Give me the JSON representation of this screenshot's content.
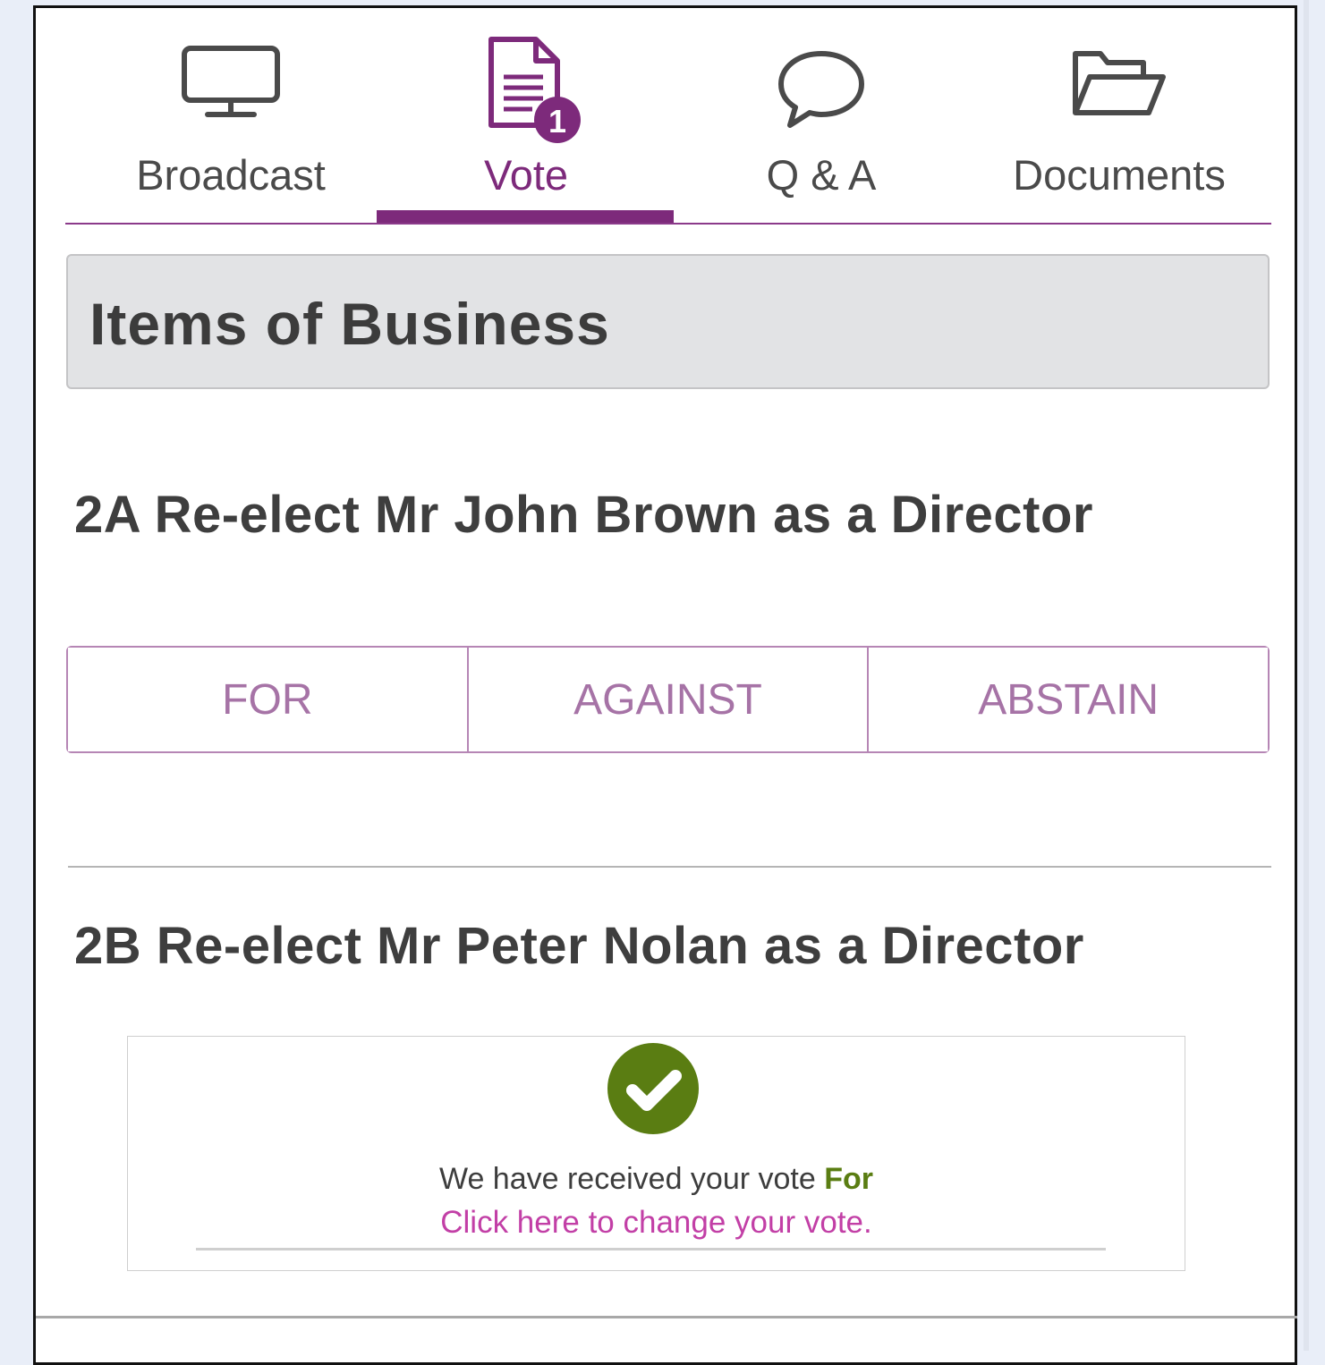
{
  "tabs": [
    {
      "label": "Broadcast",
      "icon": "monitor-icon"
    },
    {
      "label": "Vote",
      "icon": "document-icon",
      "badge": "1",
      "active": true
    },
    {
      "label": "Q & A",
      "icon": "speech-bubble-icon"
    },
    {
      "label": "Documents",
      "icon": "folder-icon"
    }
  ],
  "section": {
    "title": "Items of Business"
  },
  "resolutions": [
    {
      "title": "2A Re-elect Mr John Brown as a Director",
      "options": [
        "FOR",
        "AGAINST",
        "ABSTAIN"
      ]
    },
    {
      "title": "2B Re-elect Mr Peter Nolan as a Director",
      "confirmation": {
        "icon": "checkmark-circle-icon",
        "message": "We have received your vote",
        "vote": "For",
        "link": "Click here to change your vote."
      }
    }
  ],
  "colors": {
    "accent": "#7d2a7b",
    "check": "#5a7d12",
    "link": "#c23fa6"
  }
}
